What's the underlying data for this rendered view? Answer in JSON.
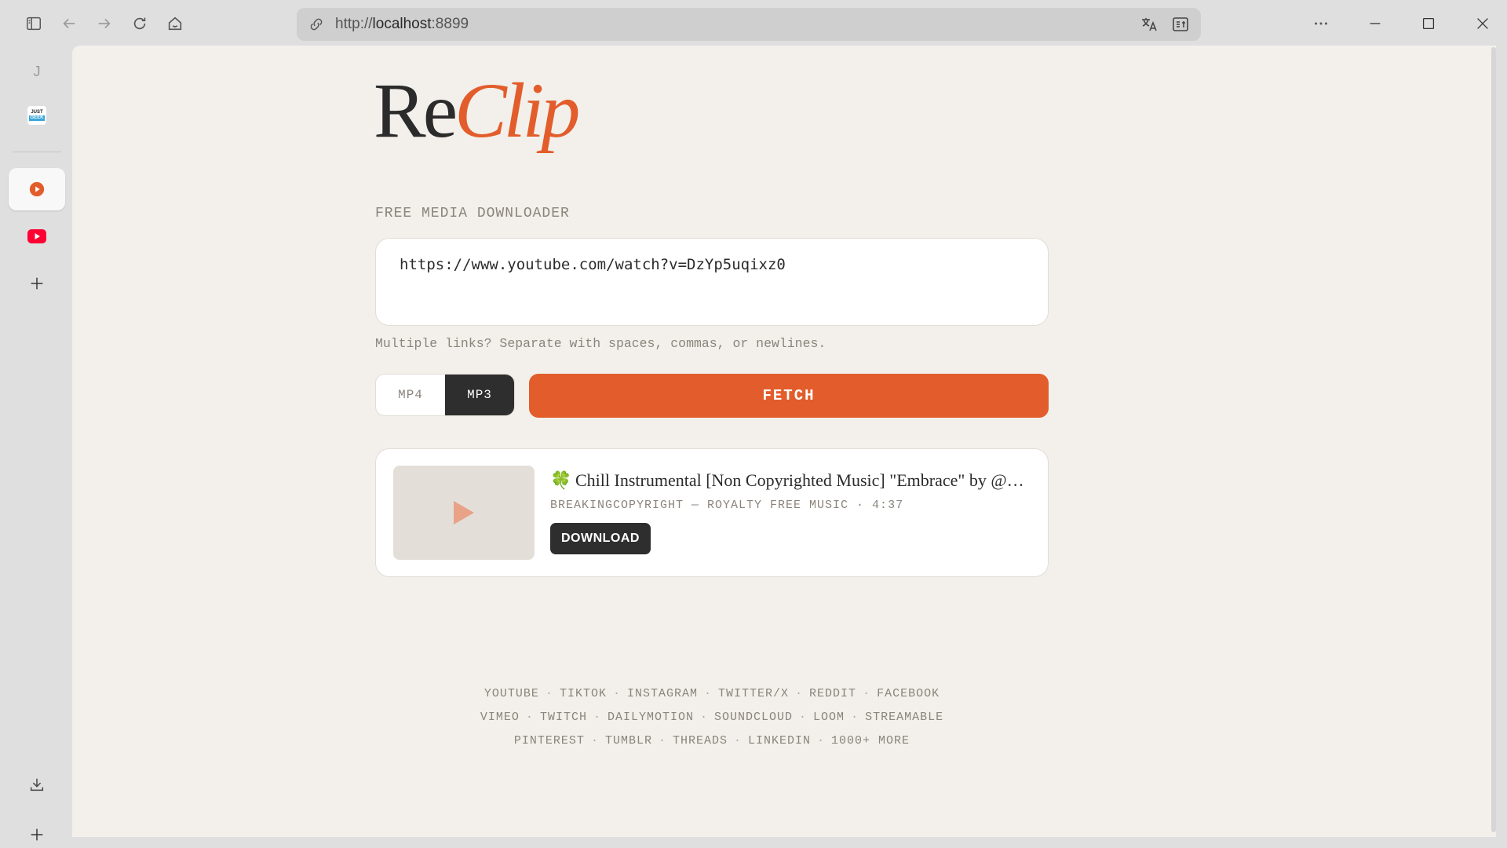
{
  "browser": {
    "url_scheme": "http://",
    "url_host": "localhost",
    "url_port": ":8899"
  },
  "sidebar": {
    "items": [
      {
        "name": "tab-j",
        "label": "J"
      },
      {
        "name": "tab-justgeek",
        "label": "JUST GEEK"
      }
    ]
  },
  "app": {
    "logo_part1": "Re",
    "logo_part2": "Clip",
    "subtitle": "FREE MEDIA DOWNLOADER",
    "url_input_value": "https://www.youtube.com/watch?v=DzYp5uqixz0",
    "hint": "Multiple links? Separate with spaces, commas, or newlines.",
    "format_options": [
      "MP4",
      "MP3"
    ],
    "selected_format": "MP3",
    "fetch_label": "FETCH",
    "result": {
      "title": "Chill Instrumental [Non Copyrighted Music] \"Embrace\" by @Sapphe...",
      "meta": "BREAKINGCOPYRIGHT — ROYALTY FREE MUSIC · 4:37",
      "download_label": "DOWNLOAD"
    },
    "platforms": [
      [
        "YOUTUBE",
        "TIKTOK",
        "INSTAGRAM",
        "TWITTER/X",
        "REDDIT",
        "FACEBOOK"
      ],
      [
        "VIMEO",
        "TWITCH",
        "DAILYMOTION",
        "SOUNDCLOUD",
        "LOOM",
        "STREAMABLE"
      ],
      [
        "PINTEREST",
        "TUMBLR",
        "THREADS",
        "LINKEDIN",
        "1000+ MORE"
      ]
    ]
  },
  "colors": {
    "accent": "#e25d2b",
    "dark": "#2e2e2e",
    "page_bg": "#f3f0eb",
    "muted_text": "#8a847c"
  }
}
